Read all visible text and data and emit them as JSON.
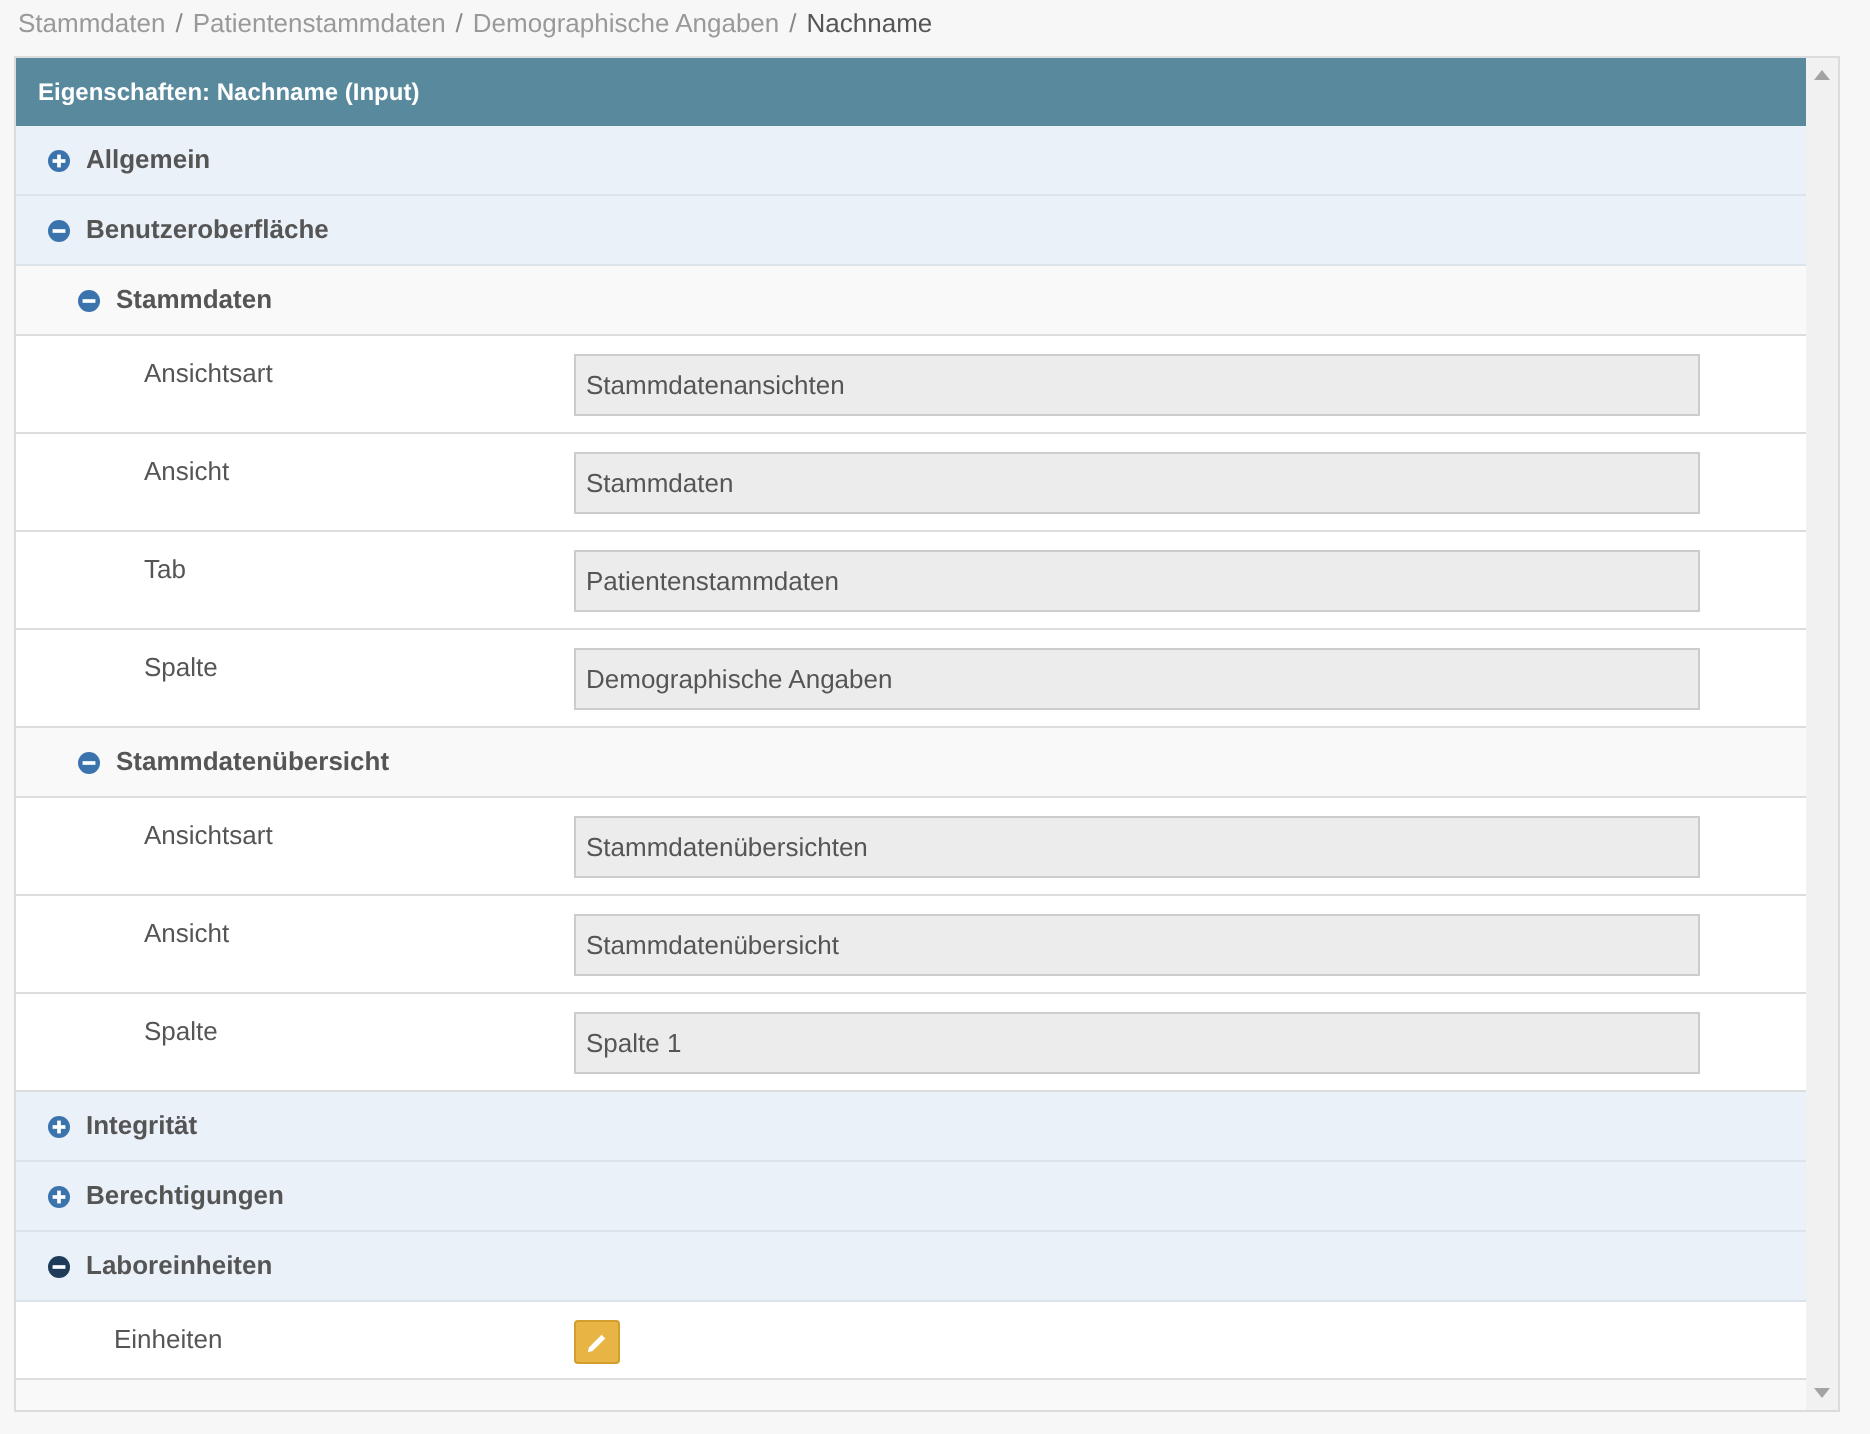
{
  "breadcrumb": [
    {
      "label": "Stammdaten",
      "current": false,
      "separator": "/"
    },
    {
      "label": "Patientenstammdaten",
      "current": false,
      "separator": "/"
    },
    {
      "label": "Demographische Angaben",
      "current": false,
      "separator": "/"
    },
    {
      "label": "Nachname",
      "current": true
    }
  ],
  "panel": {
    "title": "Eigenschaften: Nachname (Input)",
    "sections": [
      {
        "title": "Allgemein",
        "expanded": false,
        "focused": false
      },
      {
        "title": "Benutzeroberfläche",
        "expanded": true,
        "focused": false,
        "groups": [
          {
            "title": "Stammdaten",
            "expanded": true,
            "rows": [
              {
                "kind": "field",
                "label": "Ansichtsart",
                "value": "Stammdatenansichten"
              },
              {
                "kind": "field",
                "label": "Ansicht",
                "value": "Stammdaten"
              },
              {
                "kind": "field",
                "label": "Tab",
                "value": "Patientenstammdaten"
              },
              {
                "kind": "field",
                "label": "Spalte",
                "value": "Demographische Angaben"
              }
            ]
          },
          {
            "title": "Stammdatenübersicht",
            "expanded": true,
            "rows": [
              {
                "kind": "field",
                "label": "Ansichtsart",
                "value": "Stammdatenübersichten"
              },
              {
                "kind": "field",
                "label": "Ansicht",
                "value": "Stammdatenübersicht"
              },
              {
                "kind": "field",
                "label": "Spalte",
                "value": "Spalte 1"
              }
            ]
          }
        ]
      },
      {
        "title": "Integrität",
        "expanded": false,
        "focused": false
      },
      {
        "title": "Berechtigungen",
        "expanded": false,
        "focused": false
      },
      {
        "title": "Laboreinheiten",
        "expanded": true,
        "focused": true,
        "rows": [
          {
            "kind": "edit",
            "label": "Einheiten"
          }
        ]
      }
    ]
  }
}
